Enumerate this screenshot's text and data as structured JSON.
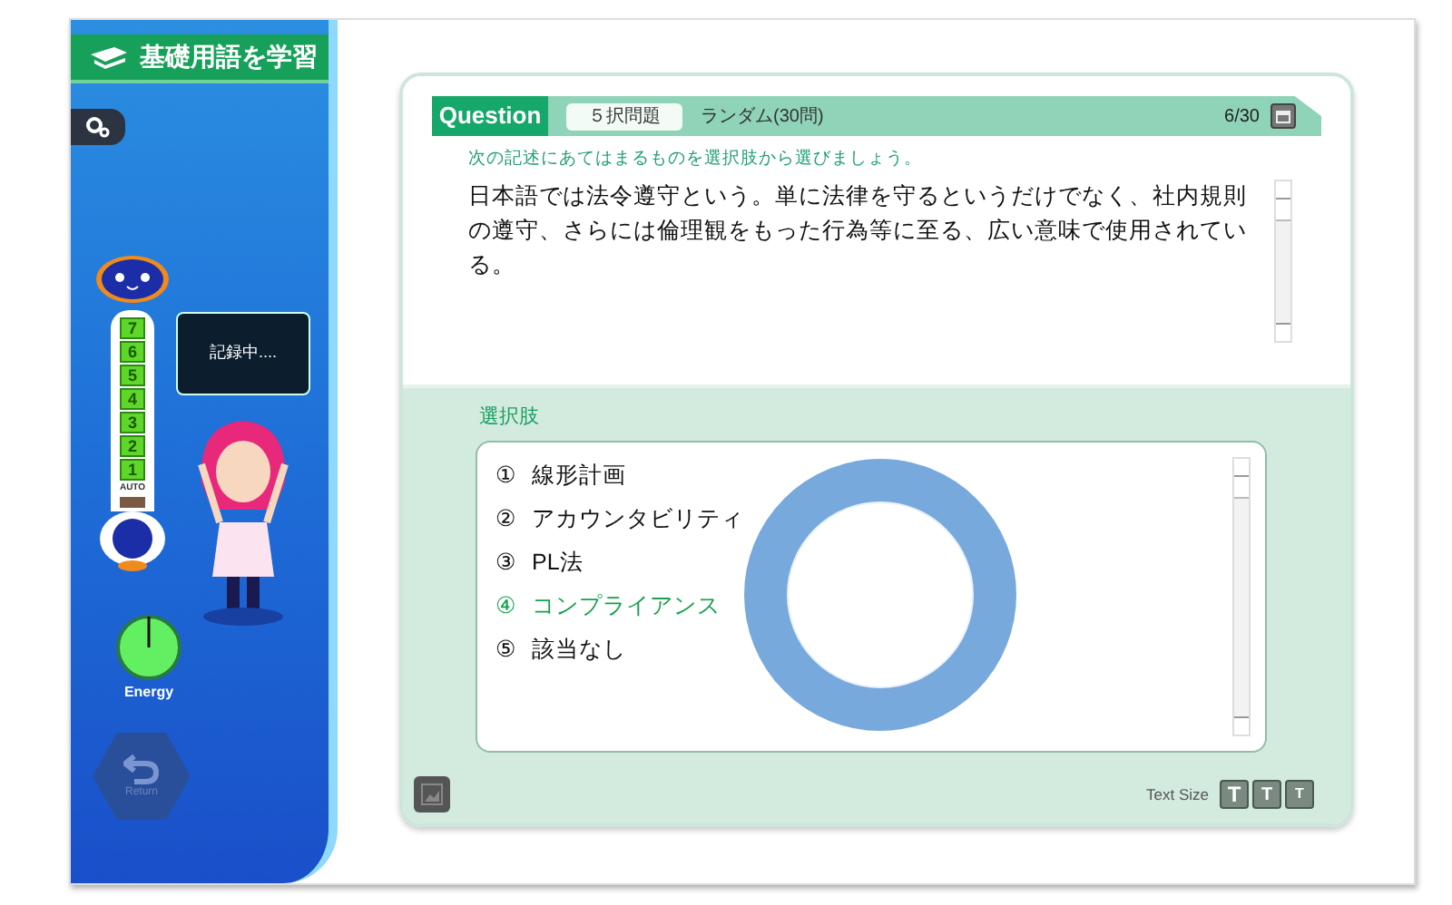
{
  "app": {
    "title": "基礎用語を学習"
  },
  "assistant": {
    "speech": "記録中....",
    "gauge_labels": [
      "7",
      "6",
      "5",
      "4",
      "3",
      "2",
      "1"
    ],
    "gauge_mode": "AUTO"
  },
  "energy": {
    "label": "Energy"
  },
  "return_button": {
    "label": "Return"
  },
  "question": {
    "heading": "Question",
    "type": "５択問題",
    "mode": "ランダム(30問)",
    "progress": "6/30",
    "instruction": "次の記述にあてはまるものを選択肢から選びましょう。",
    "text": "日本語では法令遵守という。単に法律を守るというだけでなく、社内規則の遵守、さらには倫理観をもった行為等に至る、広い意味で使用されている。"
  },
  "choices": {
    "heading": "選択肢",
    "items": [
      {
        "number": "①",
        "label": "線形計画",
        "selected": false
      },
      {
        "number": "②",
        "label": "アカウンタビリティ",
        "selected": false
      },
      {
        "number": "③",
        "label": "PL法",
        "selected": false
      },
      {
        "number": "④",
        "label": "コンプライアンス",
        "selected": true
      },
      {
        "number": "⑤",
        "label": "該当なし",
        "selected": false
      }
    ]
  },
  "text_size": {
    "label": "Text Size",
    "buttons": [
      {
        "label": "T",
        "kind": "large"
      },
      {
        "label": "T",
        "kind": "medium"
      },
      {
        "label": "T",
        "kind": "small"
      }
    ]
  }
}
